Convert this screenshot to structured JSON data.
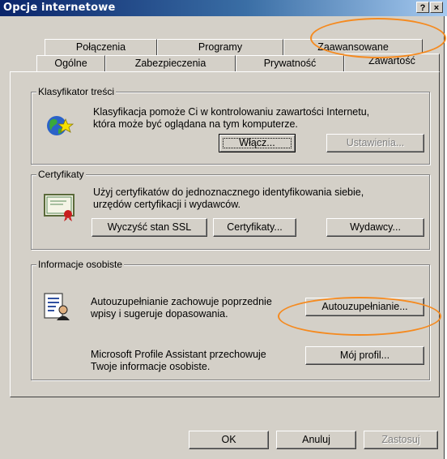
{
  "window": {
    "title": "Opcje internetowe",
    "help_glyph": "?",
    "close_glyph": "×"
  },
  "tabs_back_row": [
    {
      "label": "Połączenia"
    },
    {
      "label": "Programy"
    },
    {
      "label": "Zaawansowane"
    }
  ],
  "tabs_front_row": [
    {
      "label": "Ogólne"
    },
    {
      "label": "Zabezpieczenia"
    },
    {
      "label": "Prywatność"
    },
    {
      "label": "Zawartość",
      "active": true
    }
  ],
  "content_advisor": {
    "legend": "Klasyfikator treści",
    "description_line1": "Klasyfikacja pomoże Ci w kontrolowaniu zawartości Internetu,",
    "description_line2": "która może być oglądana na tym komputerze.",
    "enable_button": "Włącz...",
    "settings_button": "Ustawienia..."
  },
  "certificates": {
    "legend": "Certyfikaty",
    "description_line1": "Użyj certyfikatów do jednoznacznego identyfikowania siebie,",
    "description_line2": "urzędów certyfikacji i wydawców.",
    "clear_ssl_button": "Wyczyść stan SSL",
    "certificates_button": "Certyfikaty...",
    "publishers_button": "Wydawcy..."
  },
  "personal_info": {
    "legend": "Informacje osobiste",
    "autocomplete_line1": "Autouzupełnianie zachowuje poprzednie",
    "autocomplete_line2": "wpisy i sugeruje dopasowania.",
    "autocomplete_button": "Autouzupełnianie...",
    "profile_line1": "Microsoft Profile Assistant przechowuje",
    "profile_line2": "Twoje informacje osobiste.",
    "profile_button": "Mój profil..."
  },
  "footer": {
    "ok_button": "OK",
    "cancel_button": "Anuluj",
    "apply_button": "Zastosuj"
  },
  "annotation": {
    "color": "#f58a1f"
  },
  "icons": [
    "content-advisor-globe-star-icon",
    "certificate-icon",
    "profile-card-icon"
  ]
}
